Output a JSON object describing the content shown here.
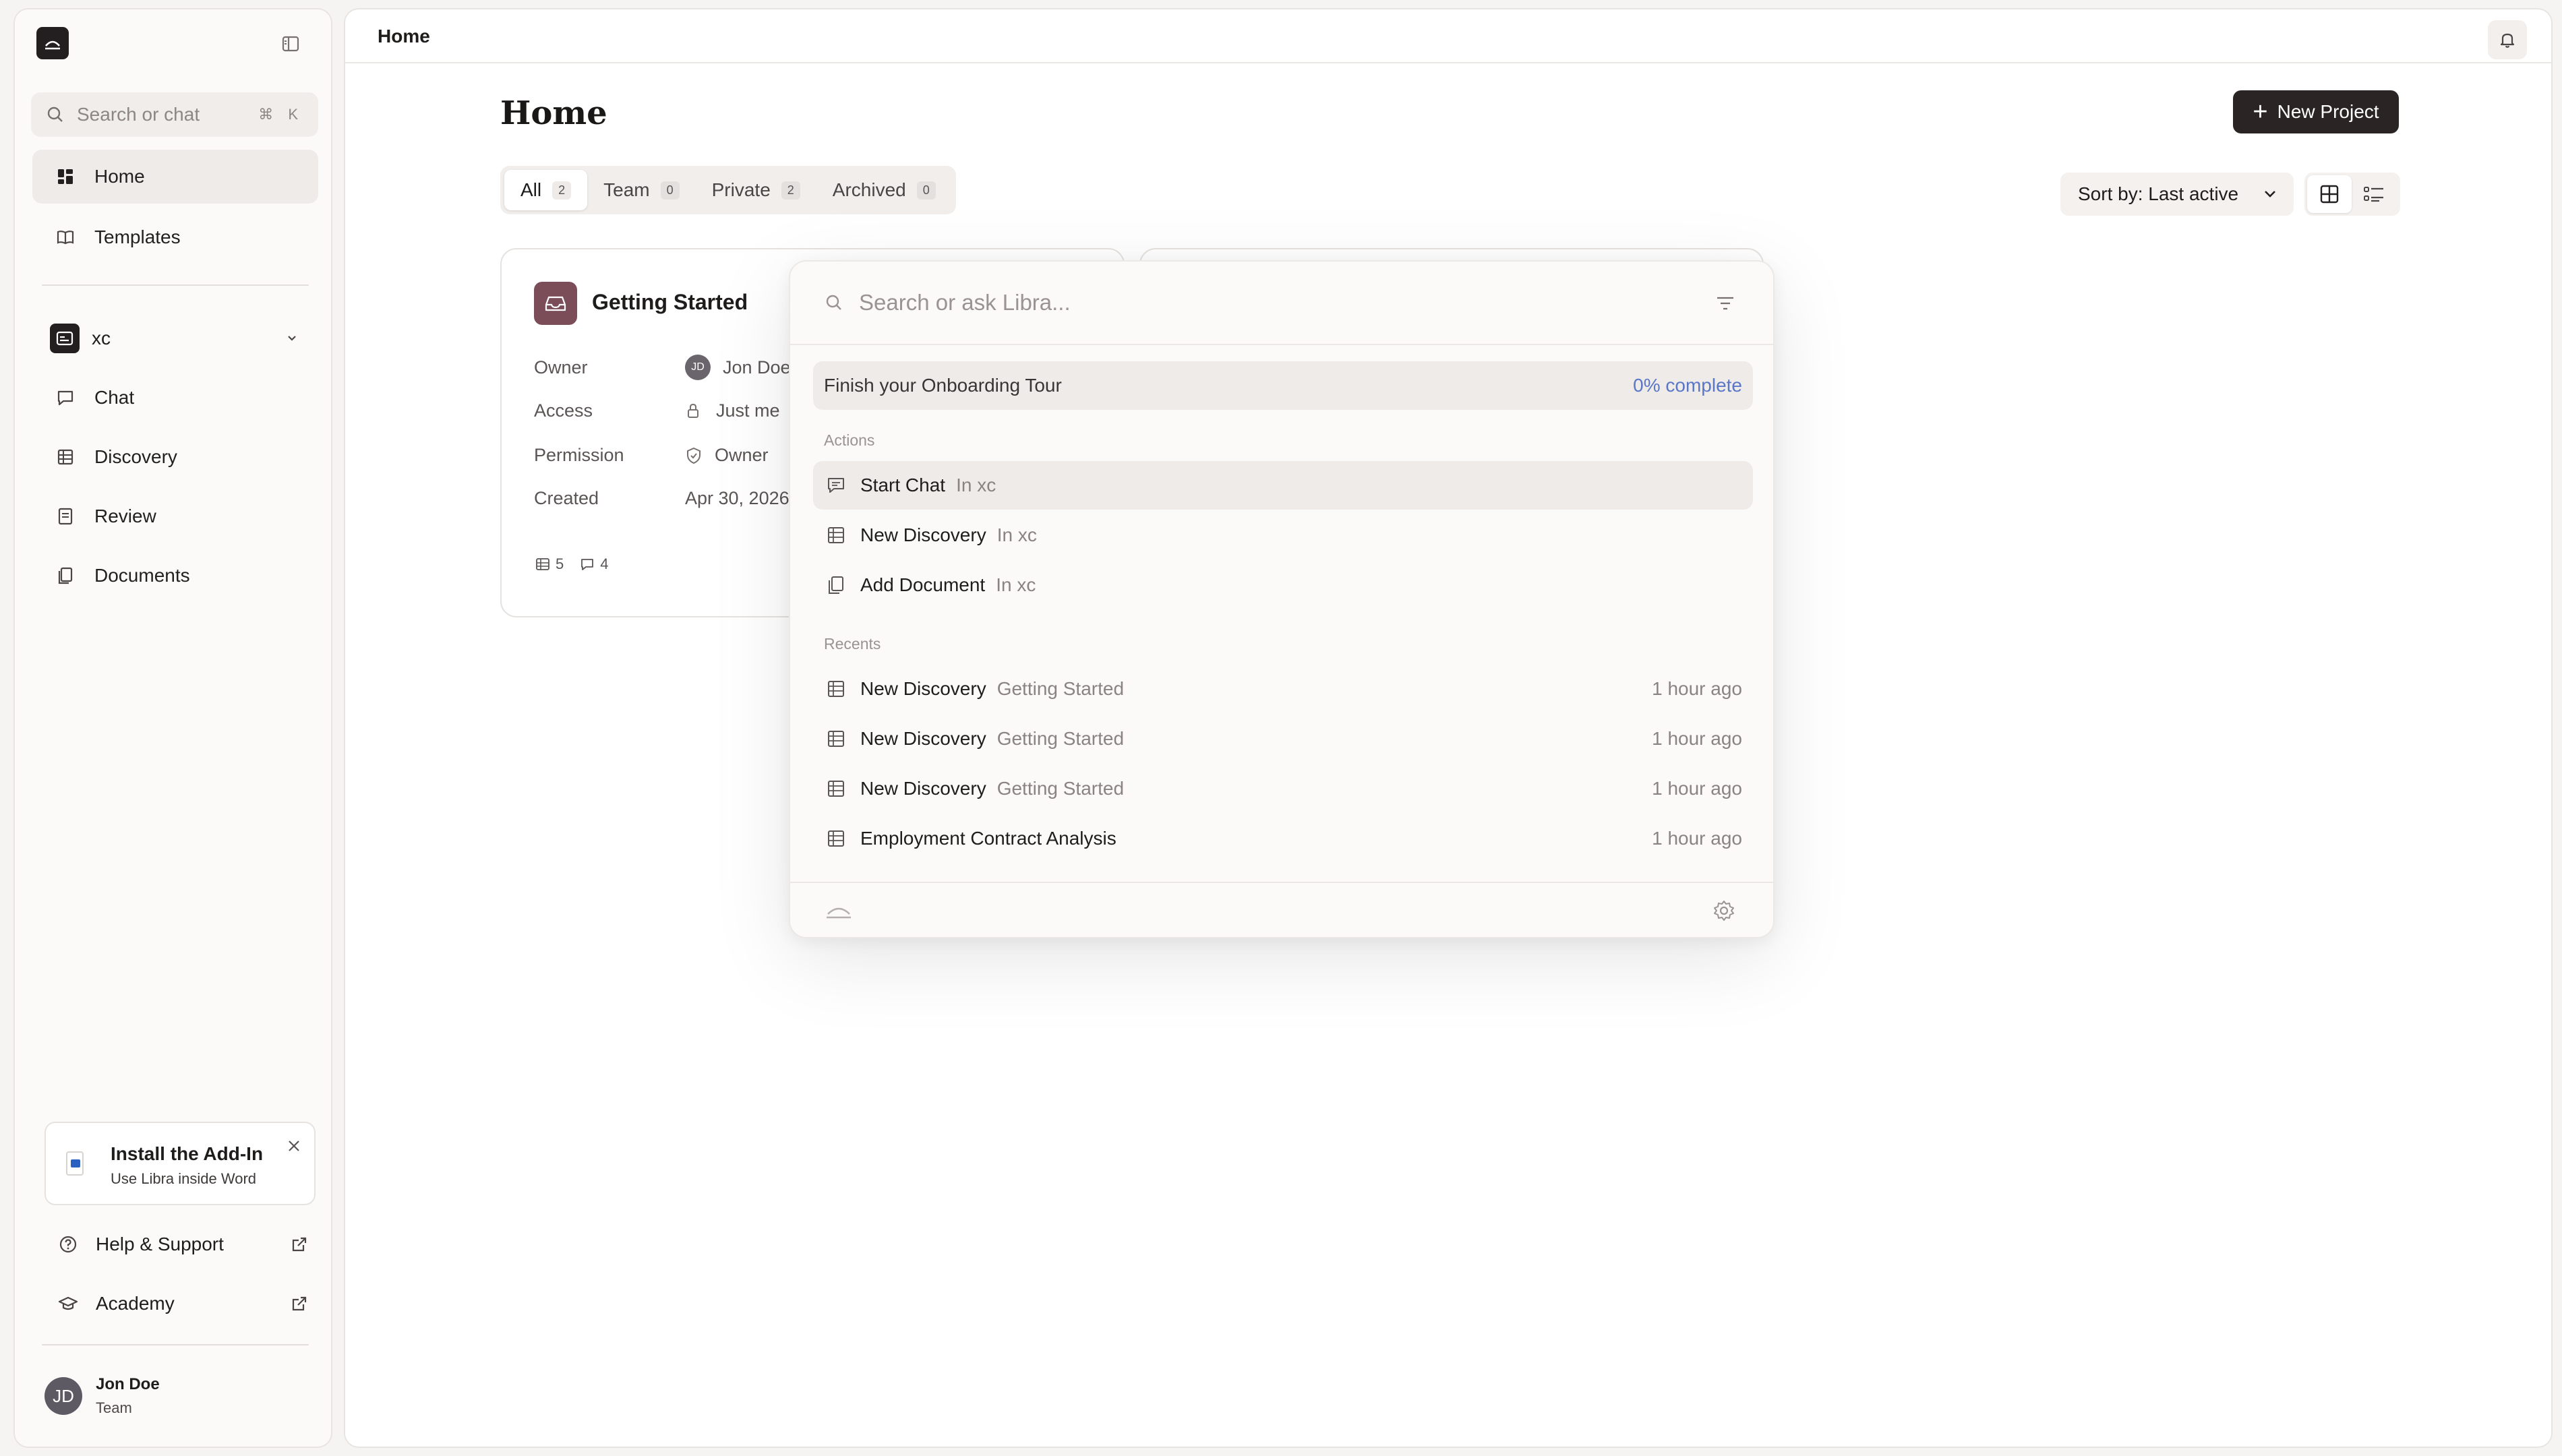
{
  "sidebar": {
    "search": {
      "placeholder": "Search or chat",
      "shortcut": "⌘ K"
    },
    "nav": [
      {
        "label": "Home",
        "icon": "home-grid-icon",
        "active": true
      },
      {
        "label": "Templates",
        "icon": "book-icon"
      }
    ],
    "workspace": {
      "name": "xc",
      "items": [
        {
          "label": "Chat",
          "icon": "chat-bubble-icon"
        },
        {
          "label": "Discovery",
          "icon": "table-icon"
        },
        {
          "label": "Review",
          "icon": "review-doc-icon"
        },
        {
          "label": "Documents",
          "icon": "documents-icon"
        }
      ]
    },
    "addin": {
      "title": "Install the Add-In",
      "subtitle": "Use Libra inside Word"
    },
    "footer_links": [
      {
        "label": "Help & Support",
        "icon": "help-circle-icon"
      },
      {
        "label": "Academy",
        "icon": "graduation-cap-icon"
      }
    ],
    "user": {
      "initials": "JD",
      "name": "Jon Doe",
      "role": "Team"
    }
  },
  "topbar": {
    "breadcrumb": "Home"
  },
  "main": {
    "title": "Home",
    "new_project_label": "New Project",
    "tabs": [
      {
        "label": "All",
        "count": "2",
        "active": true
      },
      {
        "label": "Team",
        "count": "0"
      },
      {
        "label": "Private",
        "count": "2"
      },
      {
        "label": "Archived",
        "count": "0"
      }
    ],
    "sort_label": "Sort by: Last active",
    "card": {
      "title": "Getting Started",
      "rows": [
        {
          "key": "Owner",
          "value": "Jon Doe",
          "initials": "JD"
        },
        {
          "key": "Access",
          "value": "Just me"
        },
        {
          "key": "Permission",
          "value": "Owner"
        },
        {
          "key": "Created",
          "value": "Apr 30, 2026"
        }
      ],
      "stats": {
        "discoveries": "5",
        "chats": "4"
      }
    }
  },
  "palette": {
    "placeholder": "Search or ask Libra...",
    "tour": {
      "label": "Finish your Onboarding Tour",
      "progress": "0% complete"
    },
    "actions_header": "Actions",
    "actions": [
      {
        "label": "Start Chat",
        "sub": "In xc",
        "icon": "chat-bubble-icon"
      },
      {
        "label": "New Discovery",
        "sub": "In xc",
        "icon": "table-icon"
      },
      {
        "label": "Add Document",
        "sub": "In xc",
        "icon": "documents-icon"
      }
    ],
    "recents_header": "Recents",
    "recents": [
      {
        "label": "New Discovery",
        "sub": "Getting Started",
        "time": "1 hour ago"
      },
      {
        "label": "New Discovery",
        "sub": "Getting Started",
        "time": "1 hour ago"
      },
      {
        "label": "New Discovery",
        "sub": "Getting Started",
        "time": "1 hour ago"
      },
      {
        "label": "Employment Contract Analysis",
        "sub": "",
        "time": "1 hour ago"
      }
    ]
  },
  "colors": {
    "accent": "#2a2425",
    "project_icon": "#7b4d59",
    "progress": "#5a77c7"
  }
}
